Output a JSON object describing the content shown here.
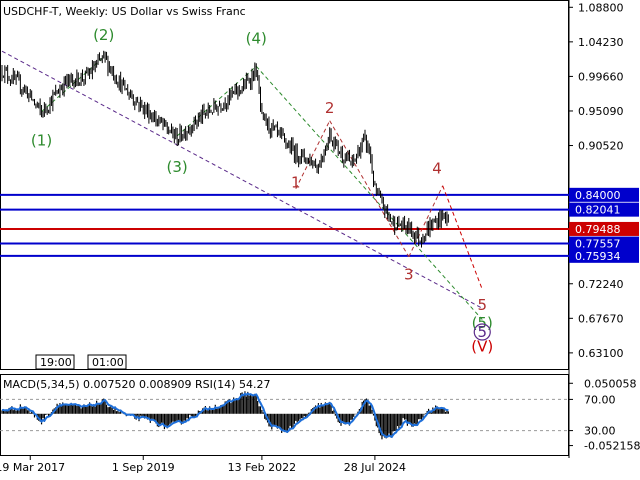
{
  "header": {
    "symbol": "USDCHF-T",
    "timeframe": "Weekly",
    "description": "US Dollar vs Swiss Franc"
  },
  "chart_data": [
    {
      "type": "line",
      "name": "price",
      "ylim": [
        0.611,
        1.095
      ],
      "xlim": [
        0,
        100
      ],
      "y_ticks": [
        "1.08800",
        "1.04230",
        "0.99660",
        "0.95090",
        "0.90520",
        "0.72240",
        "0.67670",
        "0.63100"
      ],
      "x_ticks": [
        {
          "label": "19 Mar 2017",
          "x": 5
        },
        {
          "label": "1 Sep 2019",
          "x": 25
        },
        {
          "label": "13 Feb 2022",
          "x": 46
        },
        {
          "label": "28 Jul 2024",
          "x": 66
        }
      ],
      "price_anchors": [
        [
          0,
          1.005
        ],
        [
          4,
          0.98
        ],
        [
          7,
          0.948
        ],
        [
          11,
          0.988
        ],
        [
          15,
          0.997
        ],
        [
          18,
          1.022
        ],
        [
          21,
          0.986
        ],
        [
          25,
          0.955
        ],
        [
          28,
          0.935
        ],
        [
          31,
          0.915
        ],
        [
          35,
          0.942
        ],
        [
          39,
          0.962
        ],
        [
          43,
          0.985
        ],
        [
          45,
          1.005
        ],
        [
          46,
          0.94
        ],
        [
          49,
          0.918
        ],
        [
          52,
          0.895
        ],
        [
          54,
          0.888
        ],
        [
          56,
          0.878
        ],
        [
          58,
          0.92
        ],
        [
          60,
          0.895
        ],
        [
          62,
          0.88
        ],
        [
          64,
          0.912
        ],
        [
          65,
          0.9
        ],
        [
          66,
          0.845
        ],
        [
          69,
          0.804
        ],
        [
          72,
          0.796
        ],
        [
          74,
          0.782
        ],
        [
          76,
          0.8
        ],
        [
          78,
          0.812
        ],
        [
          79,
          0.808
        ]
      ],
      "levels": [
        {
          "value": 0.84,
          "label": "0.84000",
          "color": "#0000cc"
        },
        {
          "value": 0.82041,
          "label": "0.82041",
          "color": "#0000cc"
        },
        {
          "value": 0.79488,
          "label": "0.79488",
          "color": "#cc0000"
        },
        {
          "value": 0.77557,
          "label": "0.77557",
          "color": "#0000cc"
        },
        {
          "value": 0.75934,
          "label": "0.75934",
          "color": "#0000cc"
        }
      ],
      "wave_labels": [
        {
          "text": "(1)",
          "x": 7,
          "y": 0.905,
          "color": "#2e8b2e"
        },
        {
          "text": "(2)",
          "x": 18,
          "y": 1.045,
          "color": "#2e8b2e"
        },
        {
          "text": "(3)",
          "x": 31,
          "y": 0.87,
          "color": "#2e8b2e"
        },
        {
          "text": "(4)",
          "x": 45,
          "y": 1.04,
          "color": "#2e8b2e"
        },
        {
          "text": "(5)",
          "x": 85,
          "y": 0.664,
          "color": "#2e8b2e"
        },
        {
          "text": "1",
          "x": 52,
          "y": 0.85,
          "color": "#b03030"
        },
        {
          "text": "2",
          "x": 58,
          "y": 0.948,
          "color": "#b03030"
        },
        {
          "text": "3",
          "x": 72,
          "y": 0.728,
          "color": "#b03030"
        },
        {
          "text": "4",
          "x": 77,
          "y": 0.868,
          "color": "#b03030"
        },
        {
          "text": "5",
          "x": 85,
          "y": 0.688,
          "color": "#b03030"
        },
        {
          "text": "(V)",
          "x": 85,
          "y": 0.633,
          "color": "#cc0000"
        }
      ],
      "circle_label": {
        "text": "5",
        "x": 85,
        "y": 0.652,
        "color": "#5a2a8a"
      },
      "trend_lines": [
        {
          "from": [
            0,
            1.03
          ],
          "to": [
            85,
            0.69
          ],
          "color": "#5a2a8a",
          "style": "dashed"
        },
        {
          "from": [
            7,
            0.95
          ],
          "to": [
            18,
            1.022
          ],
          "color": "#2e8b2e",
          "style": "dashed"
        },
        {
          "from": [
            31,
            0.918
          ],
          "to": [
            45,
            1.01
          ],
          "color": "#2e8b2e",
          "style": "dashed"
        },
        {
          "from": [
            45,
            1.01
          ],
          "to": [
            85,
            0.675
          ],
          "color": "#2e8b2e",
          "style": "dashed"
        },
        {
          "from": [
            52,
            0.848
          ],
          "to": [
            58,
            0.938
          ],
          "color": "#b03030",
          "style": "dashed"
        },
        {
          "from": [
            58,
            0.938
          ],
          "to": [
            72,
            0.758
          ],
          "color": "#b03030",
          "style": "dashed"
        },
        {
          "from": [
            72,
            0.758
          ],
          "to": [
            78,
            0.852
          ],
          "color": "#b03030",
          "style": "dashed"
        },
        {
          "from": [
            78,
            0.852
          ],
          "to": [
            85,
            0.715
          ],
          "color": "#cc0000",
          "style": "dashed"
        }
      ]
    },
    {
      "type": "bar",
      "name": "MACD(5,34,5) 0.007520 0.008909 RSI(14) 54.27",
      "ylim": [
        -0.066,
        0.062
      ],
      "y_ticks": [
        "0.050058",
        "70.00",
        "30.00",
        "-0.052158"
      ],
      "rsi_levels": [
        70,
        30
      ],
      "macd_anchors": [
        [
          0,
          0.006
        ],
        [
          4,
          0.012
        ],
        [
          7,
          -0.014
        ],
        [
          10,
          0.018
        ],
        [
          14,
          0.01
        ],
        [
          18,
          0.02
        ],
        [
          22,
          -0.004
        ],
        [
          26,
          -0.01
        ],
        [
          29,
          -0.022
        ],
        [
          32,
          -0.012
        ],
        [
          36,
          0.008
        ],
        [
          40,
          0.018
        ],
        [
          43,
          0.034
        ],
        [
          45,
          0.028
        ],
        [
          47,
          -0.018
        ],
        [
          50,
          -0.03
        ],
        [
          53,
          -0.01
        ],
        [
          56,
          0.014
        ],
        [
          58,
          0.016
        ],
        [
          60,
          -0.018
        ],
        [
          62,
          -0.014
        ],
        [
          64,
          0.024
        ],
        [
          65,
          0.018
        ],
        [
          67,
          -0.04
        ],
        [
          69,
          -0.036
        ],
        [
          71,
          -0.012
        ],
        [
          73,
          -0.02
        ],
        [
          75,
          0.004
        ],
        [
          77,
          0.01
        ],
        [
          79,
          0.007
        ]
      ],
      "signal_color": "#1e6fd9",
      "histogram_color": "#000000"
    }
  ],
  "time_badges": [
    "19:00",
    "01:00"
  ]
}
